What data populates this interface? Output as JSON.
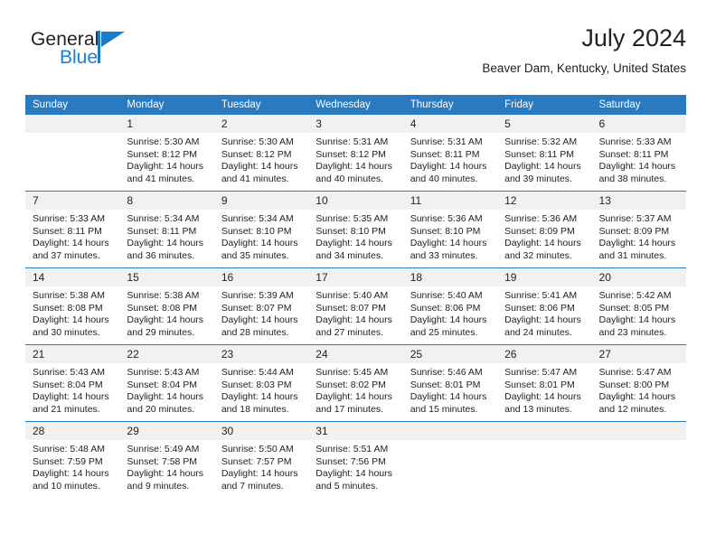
{
  "brand": {
    "name_top": "General",
    "name_bottom": "Blue",
    "color_primary": "#1f7ac4",
    "color_text": "#221f1f"
  },
  "header": {
    "month_title": "July 2024",
    "location": "Beaver Dam, Kentucky, United States"
  },
  "theme": {
    "header_bg": "#2a7ac0",
    "header_text": "#ffffff",
    "daynum_bg": "#f1f1f1",
    "cell_bg": "#ffffff",
    "rule_color": "#2a7ac0"
  },
  "calendar": {
    "weekday_headers": [
      "Sunday",
      "Monday",
      "Tuesday",
      "Wednesday",
      "Thursday",
      "Friday",
      "Saturday"
    ],
    "weeks": [
      [
        {
          "day": "",
          "sunrise": "",
          "sunset": "",
          "daylight_line1": "",
          "daylight_line2": "",
          "empty": true
        },
        {
          "day": "1",
          "sunrise": "Sunrise: 5:30 AM",
          "sunset": "Sunset: 8:12 PM",
          "daylight_line1": "Daylight: 14 hours",
          "daylight_line2": "and 41 minutes."
        },
        {
          "day": "2",
          "sunrise": "Sunrise: 5:30 AM",
          "sunset": "Sunset: 8:12 PM",
          "daylight_line1": "Daylight: 14 hours",
          "daylight_line2": "and 41 minutes."
        },
        {
          "day": "3",
          "sunrise": "Sunrise: 5:31 AM",
          "sunset": "Sunset: 8:12 PM",
          "daylight_line1": "Daylight: 14 hours",
          "daylight_line2": "and 40 minutes."
        },
        {
          "day": "4",
          "sunrise": "Sunrise: 5:31 AM",
          "sunset": "Sunset: 8:11 PM",
          "daylight_line1": "Daylight: 14 hours",
          "daylight_line2": "and 40 minutes."
        },
        {
          "day": "5",
          "sunrise": "Sunrise: 5:32 AM",
          "sunset": "Sunset: 8:11 PM",
          "daylight_line1": "Daylight: 14 hours",
          "daylight_line2": "and 39 minutes."
        },
        {
          "day": "6",
          "sunrise": "Sunrise: 5:33 AM",
          "sunset": "Sunset: 8:11 PM",
          "daylight_line1": "Daylight: 14 hours",
          "daylight_line2": "and 38 minutes."
        }
      ],
      [
        {
          "day": "7",
          "sunrise": "Sunrise: 5:33 AM",
          "sunset": "Sunset: 8:11 PM",
          "daylight_line1": "Daylight: 14 hours",
          "daylight_line2": "and 37 minutes."
        },
        {
          "day": "8",
          "sunrise": "Sunrise: 5:34 AM",
          "sunset": "Sunset: 8:11 PM",
          "daylight_line1": "Daylight: 14 hours",
          "daylight_line2": "and 36 minutes."
        },
        {
          "day": "9",
          "sunrise": "Sunrise: 5:34 AM",
          "sunset": "Sunset: 8:10 PM",
          "daylight_line1": "Daylight: 14 hours",
          "daylight_line2": "and 35 minutes."
        },
        {
          "day": "10",
          "sunrise": "Sunrise: 5:35 AM",
          "sunset": "Sunset: 8:10 PM",
          "daylight_line1": "Daylight: 14 hours",
          "daylight_line2": "and 34 minutes."
        },
        {
          "day": "11",
          "sunrise": "Sunrise: 5:36 AM",
          "sunset": "Sunset: 8:10 PM",
          "daylight_line1": "Daylight: 14 hours",
          "daylight_line2": "and 33 minutes."
        },
        {
          "day": "12",
          "sunrise": "Sunrise: 5:36 AM",
          "sunset": "Sunset: 8:09 PM",
          "daylight_line1": "Daylight: 14 hours",
          "daylight_line2": "and 32 minutes."
        },
        {
          "day": "13",
          "sunrise": "Sunrise: 5:37 AM",
          "sunset": "Sunset: 8:09 PM",
          "daylight_line1": "Daylight: 14 hours",
          "daylight_line2": "and 31 minutes."
        }
      ],
      [
        {
          "day": "14",
          "sunrise": "Sunrise: 5:38 AM",
          "sunset": "Sunset: 8:08 PM",
          "daylight_line1": "Daylight: 14 hours",
          "daylight_line2": "and 30 minutes."
        },
        {
          "day": "15",
          "sunrise": "Sunrise: 5:38 AM",
          "sunset": "Sunset: 8:08 PM",
          "daylight_line1": "Daylight: 14 hours",
          "daylight_line2": "and 29 minutes."
        },
        {
          "day": "16",
          "sunrise": "Sunrise: 5:39 AM",
          "sunset": "Sunset: 8:07 PM",
          "daylight_line1": "Daylight: 14 hours",
          "daylight_line2": "and 28 minutes."
        },
        {
          "day": "17",
          "sunrise": "Sunrise: 5:40 AM",
          "sunset": "Sunset: 8:07 PM",
          "daylight_line1": "Daylight: 14 hours",
          "daylight_line2": "and 27 minutes."
        },
        {
          "day": "18",
          "sunrise": "Sunrise: 5:40 AM",
          "sunset": "Sunset: 8:06 PM",
          "daylight_line1": "Daylight: 14 hours",
          "daylight_line2": "and 25 minutes."
        },
        {
          "day": "19",
          "sunrise": "Sunrise: 5:41 AM",
          "sunset": "Sunset: 8:06 PM",
          "daylight_line1": "Daylight: 14 hours",
          "daylight_line2": "and 24 minutes."
        },
        {
          "day": "20",
          "sunrise": "Sunrise: 5:42 AM",
          "sunset": "Sunset: 8:05 PM",
          "daylight_line1": "Daylight: 14 hours",
          "daylight_line2": "and 23 minutes."
        }
      ],
      [
        {
          "day": "21",
          "sunrise": "Sunrise: 5:43 AM",
          "sunset": "Sunset: 8:04 PM",
          "daylight_line1": "Daylight: 14 hours",
          "daylight_line2": "and 21 minutes."
        },
        {
          "day": "22",
          "sunrise": "Sunrise: 5:43 AM",
          "sunset": "Sunset: 8:04 PM",
          "daylight_line1": "Daylight: 14 hours",
          "daylight_line2": "and 20 minutes."
        },
        {
          "day": "23",
          "sunrise": "Sunrise: 5:44 AM",
          "sunset": "Sunset: 8:03 PM",
          "daylight_line1": "Daylight: 14 hours",
          "daylight_line2": "and 18 minutes."
        },
        {
          "day": "24",
          "sunrise": "Sunrise: 5:45 AM",
          "sunset": "Sunset: 8:02 PM",
          "daylight_line1": "Daylight: 14 hours",
          "daylight_line2": "and 17 minutes."
        },
        {
          "day": "25",
          "sunrise": "Sunrise: 5:46 AM",
          "sunset": "Sunset: 8:01 PM",
          "daylight_line1": "Daylight: 14 hours",
          "daylight_line2": "and 15 minutes."
        },
        {
          "day": "26",
          "sunrise": "Sunrise: 5:47 AM",
          "sunset": "Sunset: 8:01 PM",
          "daylight_line1": "Daylight: 14 hours",
          "daylight_line2": "and 13 minutes."
        },
        {
          "day": "27",
          "sunrise": "Sunrise: 5:47 AM",
          "sunset": "Sunset: 8:00 PM",
          "daylight_line1": "Daylight: 14 hours",
          "daylight_line2": "and 12 minutes."
        }
      ],
      [
        {
          "day": "28",
          "sunrise": "Sunrise: 5:48 AM",
          "sunset": "Sunset: 7:59 PM",
          "daylight_line1": "Daylight: 14 hours",
          "daylight_line2": "and 10 minutes."
        },
        {
          "day": "29",
          "sunrise": "Sunrise: 5:49 AM",
          "sunset": "Sunset: 7:58 PM",
          "daylight_line1": "Daylight: 14 hours",
          "daylight_line2": "and 9 minutes."
        },
        {
          "day": "30",
          "sunrise": "Sunrise: 5:50 AM",
          "sunset": "Sunset: 7:57 PM",
          "daylight_line1": "Daylight: 14 hours",
          "daylight_line2": "and 7 minutes."
        },
        {
          "day": "31",
          "sunrise": "Sunrise: 5:51 AM",
          "sunset": "Sunset: 7:56 PM",
          "daylight_line1": "Daylight: 14 hours",
          "daylight_line2": "and 5 minutes."
        },
        {
          "day": "",
          "sunrise": "",
          "sunset": "",
          "daylight_line1": "",
          "daylight_line2": "",
          "empty": true
        },
        {
          "day": "",
          "sunrise": "",
          "sunset": "",
          "daylight_line1": "",
          "daylight_line2": "",
          "empty": true
        },
        {
          "day": "",
          "sunrise": "",
          "sunset": "",
          "daylight_line1": "",
          "daylight_line2": "",
          "empty": true
        }
      ]
    ]
  }
}
